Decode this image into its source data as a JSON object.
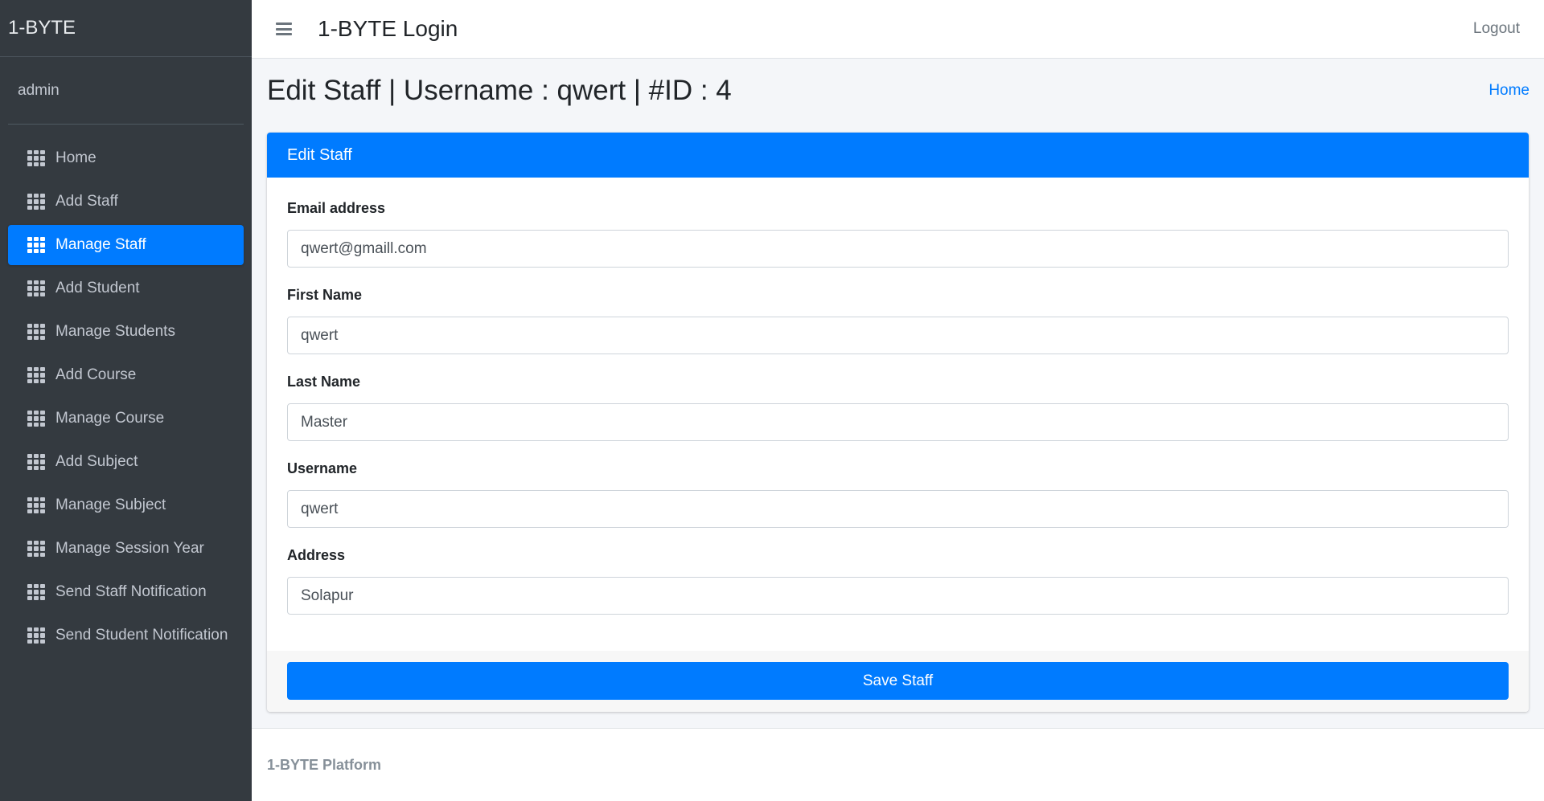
{
  "sidebar": {
    "brand": "1-BYTE",
    "user": "admin",
    "items": [
      {
        "label": "Home",
        "icon": "th-icon"
      },
      {
        "label": "Add Staff",
        "icon": "th-icon"
      },
      {
        "label": "Manage Staff",
        "icon": "th-icon",
        "active": true
      },
      {
        "label": "Add Student",
        "icon": "th-icon"
      },
      {
        "label": "Manage Students",
        "icon": "th-icon"
      },
      {
        "label": "Add Course",
        "icon": "th-icon"
      },
      {
        "label": "Manage Course",
        "icon": "th-icon"
      },
      {
        "label": "Add Subject",
        "icon": "th-icon"
      },
      {
        "label": "Manage Subject",
        "icon": "th-icon"
      },
      {
        "label": "Manage Session Year",
        "icon": "th-icon"
      },
      {
        "label": "Send Staff Notification",
        "icon": "th-icon"
      },
      {
        "label": "Send Student Notification",
        "icon": "th-icon"
      }
    ]
  },
  "navbar": {
    "menu_icon": "hamburger-icon",
    "title": "1-BYTE Login",
    "logout": "Logout"
  },
  "header": {
    "title": "Edit Staff | Username : qwert | #ID : 4",
    "breadcrumb_home": "Home"
  },
  "card": {
    "title": "Edit Staff",
    "fields": {
      "email": {
        "label": "Email address",
        "value": "qwert@gmaill.com"
      },
      "first_name": {
        "label": "First Name",
        "value": "qwert"
      },
      "last_name": {
        "label": "Last Name",
        "value": "Master"
      },
      "username": {
        "label": "Username",
        "value": "qwert"
      },
      "address": {
        "label": "Address",
        "value": "Solapur"
      }
    },
    "save_label": "Save Staff"
  },
  "footer": {
    "text": "1-BYTE Platform"
  },
  "colors": {
    "sidebar_bg": "#343a40",
    "primary": "#007bff",
    "content_bg": "#f4f6f9"
  }
}
